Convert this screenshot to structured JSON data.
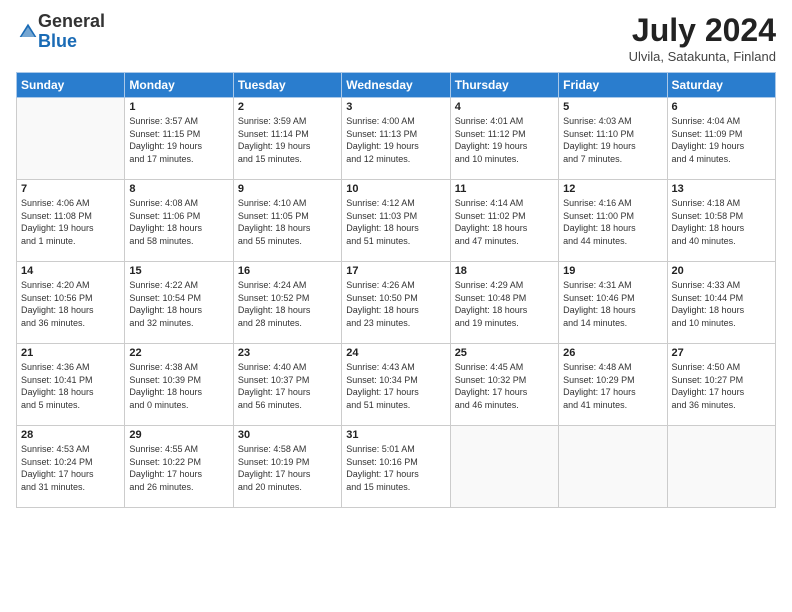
{
  "header": {
    "logo_line1": "General",
    "logo_line2": "Blue",
    "month_year": "July 2024",
    "location": "Ulvila, Satakunta, Finland"
  },
  "days_of_week": [
    "Sunday",
    "Monday",
    "Tuesday",
    "Wednesday",
    "Thursday",
    "Friday",
    "Saturday"
  ],
  "weeks": [
    [
      {
        "num": "",
        "info": ""
      },
      {
        "num": "1",
        "info": "Sunrise: 3:57 AM\nSunset: 11:15 PM\nDaylight: 19 hours\nand 17 minutes."
      },
      {
        "num": "2",
        "info": "Sunrise: 3:59 AM\nSunset: 11:14 PM\nDaylight: 19 hours\nand 15 minutes."
      },
      {
        "num": "3",
        "info": "Sunrise: 4:00 AM\nSunset: 11:13 PM\nDaylight: 19 hours\nand 12 minutes."
      },
      {
        "num": "4",
        "info": "Sunrise: 4:01 AM\nSunset: 11:12 PM\nDaylight: 19 hours\nand 10 minutes."
      },
      {
        "num": "5",
        "info": "Sunrise: 4:03 AM\nSunset: 11:10 PM\nDaylight: 19 hours\nand 7 minutes."
      },
      {
        "num": "6",
        "info": "Sunrise: 4:04 AM\nSunset: 11:09 PM\nDaylight: 19 hours\nand 4 minutes."
      }
    ],
    [
      {
        "num": "7",
        "info": "Sunrise: 4:06 AM\nSunset: 11:08 PM\nDaylight: 19 hours\nand 1 minute."
      },
      {
        "num": "8",
        "info": "Sunrise: 4:08 AM\nSunset: 11:06 PM\nDaylight: 18 hours\nand 58 minutes."
      },
      {
        "num": "9",
        "info": "Sunrise: 4:10 AM\nSunset: 11:05 PM\nDaylight: 18 hours\nand 55 minutes."
      },
      {
        "num": "10",
        "info": "Sunrise: 4:12 AM\nSunset: 11:03 PM\nDaylight: 18 hours\nand 51 minutes."
      },
      {
        "num": "11",
        "info": "Sunrise: 4:14 AM\nSunset: 11:02 PM\nDaylight: 18 hours\nand 47 minutes."
      },
      {
        "num": "12",
        "info": "Sunrise: 4:16 AM\nSunset: 11:00 PM\nDaylight: 18 hours\nand 44 minutes."
      },
      {
        "num": "13",
        "info": "Sunrise: 4:18 AM\nSunset: 10:58 PM\nDaylight: 18 hours\nand 40 minutes."
      }
    ],
    [
      {
        "num": "14",
        "info": "Sunrise: 4:20 AM\nSunset: 10:56 PM\nDaylight: 18 hours\nand 36 minutes."
      },
      {
        "num": "15",
        "info": "Sunrise: 4:22 AM\nSunset: 10:54 PM\nDaylight: 18 hours\nand 32 minutes."
      },
      {
        "num": "16",
        "info": "Sunrise: 4:24 AM\nSunset: 10:52 PM\nDaylight: 18 hours\nand 28 minutes."
      },
      {
        "num": "17",
        "info": "Sunrise: 4:26 AM\nSunset: 10:50 PM\nDaylight: 18 hours\nand 23 minutes."
      },
      {
        "num": "18",
        "info": "Sunrise: 4:29 AM\nSunset: 10:48 PM\nDaylight: 18 hours\nand 19 minutes."
      },
      {
        "num": "19",
        "info": "Sunrise: 4:31 AM\nSunset: 10:46 PM\nDaylight: 18 hours\nand 14 minutes."
      },
      {
        "num": "20",
        "info": "Sunrise: 4:33 AM\nSunset: 10:44 PM\nDaylight: 18 hours\nand 10 minutes."
      }
    ],
    [
      {
        "num": "21",
        "info": "Sunrise: 4:36 AM\nSunset: 10:41 PM\nDaylight: 18 hours\nand 5 minutes."
      },
      {
        "num": "22",
        "info": "Sunrise: 4:38 AM\nSunset: 10:39 PM\nDaylight: 18 hours\nand 0 minutes."
      },
      {
        "num": "23",
        "info": "Sunrise: 4:40 AM\nSunset: 10:37 PM\nDaylight: 17 hours\nand 56 minutes."
      },
      {
        "num": "24",
        "info": "Sunrise: 4:43 AM\nSunset: 10:34 PM\nDaylight: 17 hours\nand 51 minutes."
      },
      {
        "num": "25",
        "info": "Sunrise: 4:45 AM\nSunset: 10:32 PM\nDaylight: 17 hours\nand 46 minutes."
      },
      {
        "num": "26",
        "info": "Sunrise: 4:48 AM\nSunset: 10:29 PM\nDaylight: 17 hours\nand 41 minutes."
      },
      {
        "num": "27",
        "info": "Sunrise: 4:50 AM\nSunset: 10:27 PM\nDaylight: 17 hours\nand 36 minutes."
      }
    ],
    [
      {
        "num": "28",
        "info": "Sunrise: 4:53 AM\nSunset: 10:24 PM\nDaylight: 17 hours\nand 31 minutes."
      },
      {
        "num": "29",
        "info": "Sunrise: 4:55 AM\nSunset: 10:22 PM\nDaylight: 17 hours\nand 26 minutes."
      },
      {
        "num": "30",
        "info": "Sunrise: 4:58 AM\nSunset: 10:19 PM\nDaylight: 17 hours\nand 20 minutes."
      },
      {
        "num": "31",
        "info": "Sunrise: 5:01 AM\nSunset: 10:16 PM\nDaylight: 17 hours\nand 15 minutes."
      },
      {
        "num": "",
        "info": ""
      },
      {
        "num": "",
        "info": ""
      },
      {
        "num": "",
        "info": ""
      }
    ]
  ]
}
